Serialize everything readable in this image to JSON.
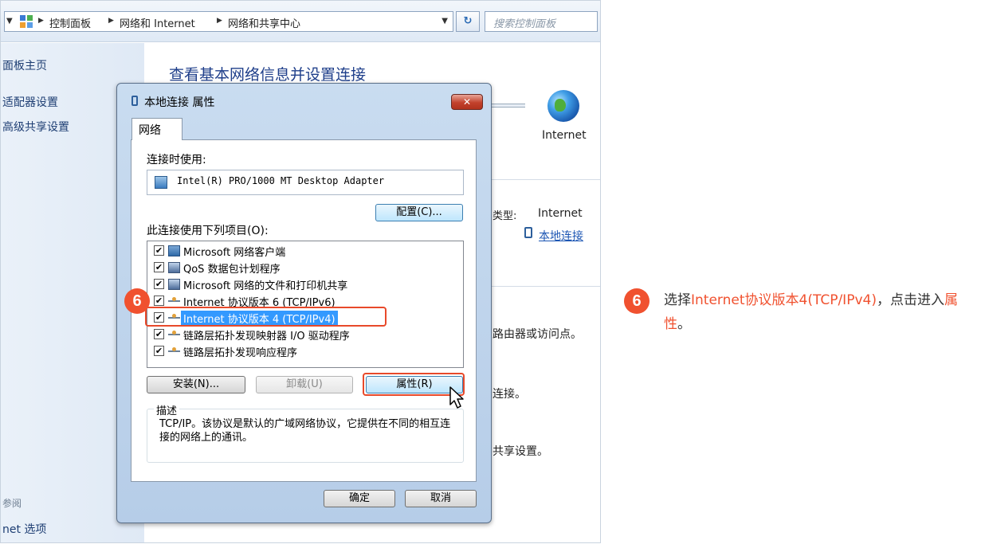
{
  "explorer": {
    "breadcrumbs": [
      "控制面板",
      "网络和 Internet",
      "网络和共享中心"
    ],
    "search_placeholder": "搜索控制面板",
    "left_pane": {
      "items": [
        "面板主页",
        "适配器设置",
        "高级共享设置"
      ],
      "see_also_label": "参阅",
      "see_also_items": [
        "net 选项"
      ]
    },
    "main": {
      "title": "查看基本网络信息并设置连接",
      "internet_label": "Internet",
      "type_label": "类型:",
      "type_value": "Internet",
      "connection_link": "本地连接",
      "text_router": "路由器或访问点。",
      "text_connect": "连接。",
      "text_share": "共享设置。"
    }
  },
  "dialog": {
    "title": "本地连接 属性",
    "close_label": "✕",
    "tab_label": "网络",
    "connect_using_label": "连接时使用:",
    "adapter_name": "Intel(R) PRO/1000 MT Desktop Adapter",
    "configure_button": "配置(C)...",
    "items_label": "此连接使用下列项目(O):",
    "items": [
      {
        "label": "Microsoft 网络客户端",
        "checked": true,
        "icon": "network-client-icon"
      },
      {
        "label": "QoS 数据包计划程序",
        "checked": true,
        "icon": "service-icon"
      },
      {
        "label": "Microsoft 网络的文件和打印机共享",
        "checked": true,
        "icon": "service-icon"
      },
      {
        "label": "Internet 协议版本 6 (TCP/IPv6)",
        "checked": true,
        "icon": "protocol-icon"
      },
      {
        "label": "Internet 协议版本 4 (TCP/IPv4)",
        "checked": true,
        "icon": "protocol-icon",
        "selected": true
      },
      {
        "label": "链路层拓扑发现映射器 I/O 驱动程序",
        "checked": true,
        "icon": "protocol-icon"
      },
      {
        "label": "链路层拓扑发现响应程序",
        "checked": true,
        "icon": "protocol-icon"
      }
    ],
    "install_button": "安装(N)...",
    "uninstall_button": "卸载(U)",
    "properties_button": "属性(R)",
    "description_label": "描述",
    "description_text": "TCP/IP。该协议是默认的广域网络协议，它提供在不同的相互连接的网络上的通讯。",
    "ok_button": "确定",
    "cancel_button": "取消"
  },
  "annotation": {
    "step_number": "6",
    "instruction_prefix": "选择",
    "instruction_highlight_1": "Internet协议版本4(TCP/IPv4)",
    "instruction_mid": "，点击进入",
    "instruction_highlight_2": "属性",
    "instruction_suffix": "。",
    "accent_color": "#f0512f"
  }
}
